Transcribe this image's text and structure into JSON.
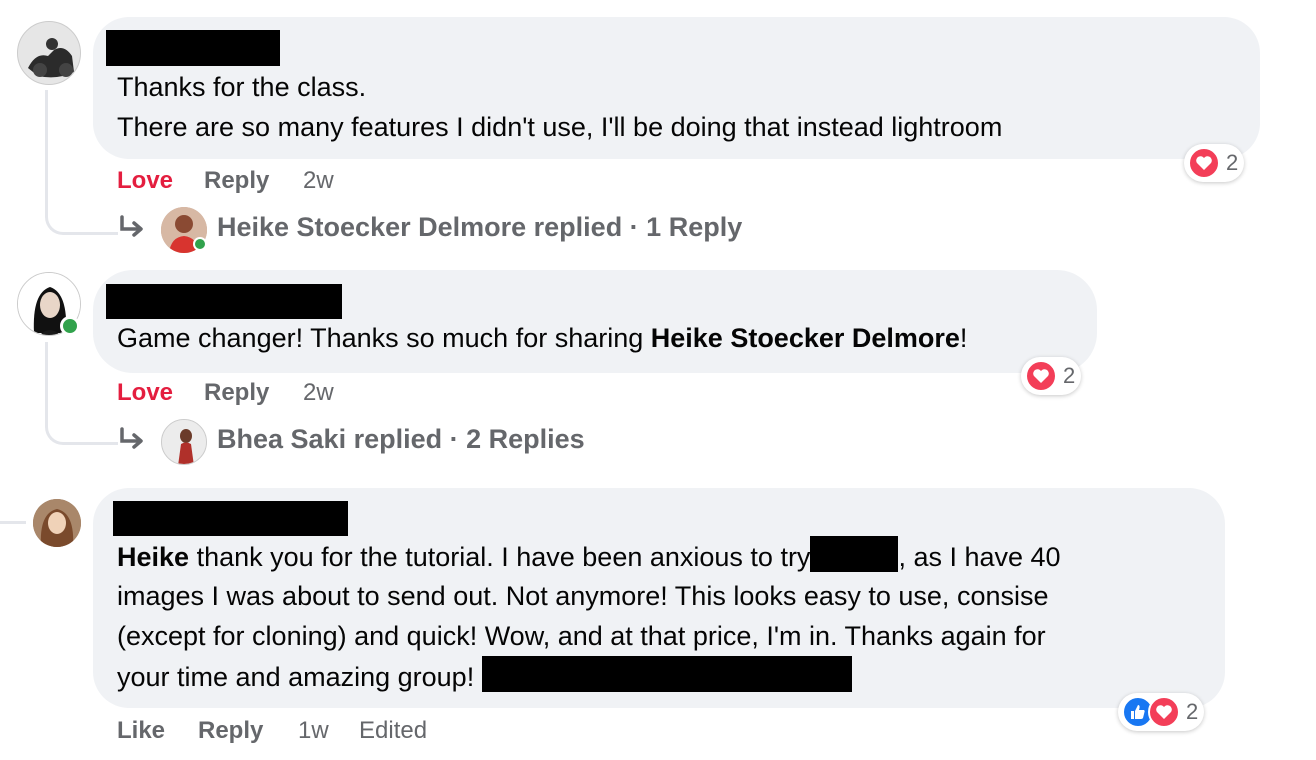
{
  "comments": [
    {
      "name_redacted": true,
      "text_lines": [
        "Thanks for the class.",
        "There are so many features I didn't use, I'll be doing that instead lightroom"
      ],
      "actions": {
        "reaction": "Love",
        "reply": "Reply",
        "time": "2w"
      },
      "reactions": {
        "types": [
          "love"
        ],
        "count": "2"
      },
      "replies": {
        "summary": "Heike Stoecker Delmore replied · 1 Reply",
        "replier_online": true
      }
    },
    {
      "name_redacted": true,
      "author_online": true,
      "text_prefix": "Game changer! Thanks so much for sharing ",
      "text_mention": "Heike Stoecker Delmore",
      "text_suffix": "!",
      "actions": {
        "reaction": "Love",
        "reply": "Reply",
        "time": "2w"
      },
      "reactions": {
        "types": [
          "love"
        ],
        "count": "2"
      },
      "replies": {
        "summary": "Bhea Saki replied · 2 Replies"
      }
    },
    {
      "name_redacted": true,
      "text_mention": "Heike",
      "text_line1_a": " thank you for the tutorial. I have been anxious to try",
      "text_line1_b": ", as I have 40",
      "text_line2": "images I was about to send out. Not anymore! This looks easy to use, consise",
      "text_line3": "(except for cloning) and quick! Wow, and at that price, I'm in. Thanks again for",
      "text_line4": "your time and amazing group!",
      "actions": {
        "reaction": "Like",
        "reply": "Reply",
        "time": "1w",
        "edited": "Edited"
      },
      "reactions": {
        "types": [
          "like",
          "love"
        ],
        "count": "2"
      }
    }
  ],
  "colors": {
    "bubble": "#f0f2f5",
    "love": "#e41e3f",
    "meta": "#65676b",
    "like": "#1877f2",
    "online": "#31a24c"
  },
  "icons": [
    "heart-icon",
    "thumbs-up-icon",
    "reply-arrow-icon"
  ]
}
